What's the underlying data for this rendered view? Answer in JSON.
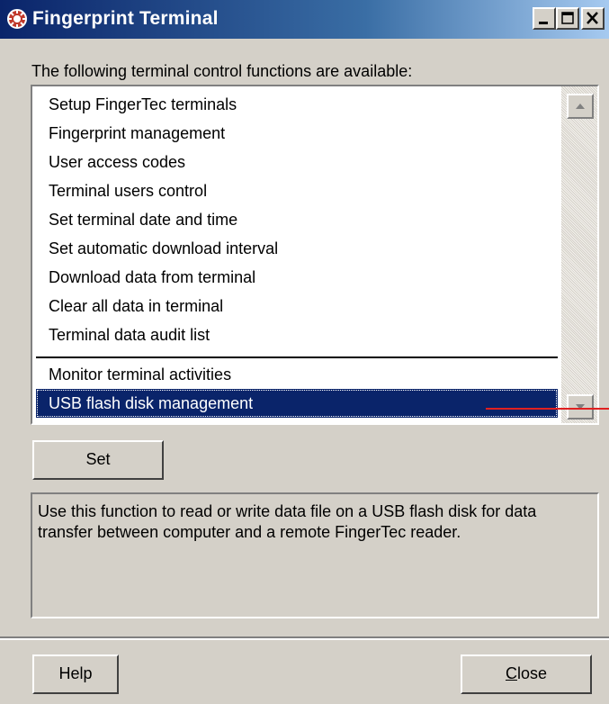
{
  "window": {
    "title": "Fingerprint Terminal",
    "icon": "fingertec-icon",
    "controls": [
      "minimize-icon",
      "maximize-icon",
      "close-icon"
    ]
  },
  "intro_text": "The following terminal control functions are available:",
  "functions": [
    "Setup FingerTec terminals",
    "Fingerprint management",
    "User access codes",
    "Terminal users control",
    "Set terminal date and time",
    "Set automatic download interval",
    "Download data from terminal",
    "Clear all data in terminal",
    "Terminal data audit list",
    "Monitor terminal activities",
    "USB flash disk management"
  ],
  "selected_function": "USB flash disk management",
  "set_button": "Set",
  "description": "Use this function to read or write data file on a USB flash disk for data transfer between computer and a remote FingerTec reader.",
  "help_button": "Help",
  "close_button": {
    "first": "C",
    "rest": "lose"
  },
  "colors": {
    "title_bar": "#0a246a",
    "selection": "#0a246a",
    "face": "#d4d0c8",
    "annotation": "#e02020"
  }
}
